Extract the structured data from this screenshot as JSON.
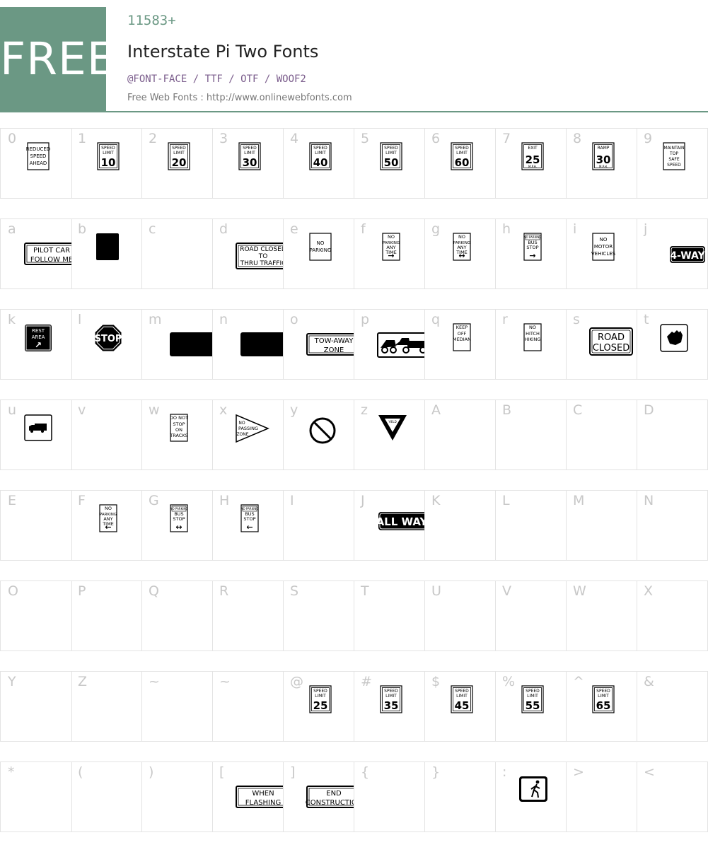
{
  "header": {
    "badge": "FREE",
    "count": "11583+",
    "title": "Interstate Pi Two Fonts",
    "formats": "@FONT-FACE / TTF / OTF / WOOF2",
    "site": "Free Web Fonts : http://www.onlinewebfonts.com"
  },
  "rows": [
    [
      {
        "char": "0",
        "sign": "sq",
        "lines": [
          "REDUCED",
          "SPEED",
          "AHEAD"
        ]
      },
      {
        "char": "1",
        "sign": "speed",
        "top": [
          "SPEED",
          "LIMIT"
        ],
        "num": "10"
      },
      {
        "char": "2",
        "sign": "speed",
        "top": [
          "SPEED",
          "LIMIT"
        ],
        "num": "20"
      },
      {
        "char": "3",
        "sign": "speed",
        "top": [
          "SPEED",
          "LIMIT"
        ],
        "num": "30"
      },
      {
        "char": "4",
        "sign": "speed",
        "top": [
          "SPEED",
          "LIMIT"
        ],
        "num": "40"
      },
      {
        "char": "5",
        "sign": "speed",
        "top": [
          "SPEED",
          "LIMIT"
        ],
        "num": "50"
      },
      {
        "char": "6",
        "sign": "speed",
        "top": [
          "SPEED",
          "LIMIT"
        ],
        "num": "60"
      },
      {
        "char": "7",
        "sign": "speed",
        "top": [
          "EXIT"
        ],
        "num": "25",
        "bottom": "M.P.H."
      },
      {
        "char": "8",
        "sign": "speed",
        "top": [
          "RAMP"
        ],
        "num": "30",
        "bottom": "M.P.H."
      },
      {
        "char": "9",
        "sign": "sq",
        "lines": [
          "MAINTAIN",
          "TOP",
          "SAFE",
          "SPEED"
        ]
      }
    ],
    [
      {
        "char": "a",
        "sign": "wide",
        "lines": [
          "PILOT CAR",
          "FOLLOW ME"
        ]
      },
      {
        "char": "b",
        "sign": "blackbox"
      },
      {
        "char": "c",
        "sign": "none"
      },
      {
        "char": "d",
        "sign": "wide2",
        "lines": [
          "ROAD  CLOSED",
          "TO",
          "THRU  TRAFFIC"
        ]
      },
      {
        "char": "e",
        "sign": "sq",
        "lines": [
          "NO",
          "PARKING"
        ]
      },
      {
        "char": "f",
        "sign": "tall",
        "lines": [
          "NO",
          "PARKING",
          "ANY",
          "TIME"
        ],
        "arrow": "→"
      },
      {
        "char": "g",
        "sign": "tall",
        "lines": [
          "NO",
          "PARKING",
          "ANY",
          "TIME"
        ],
        "arrow": "↔"
      },
      {
        "char": "h",
        "sign": "tall",
        "lines": [
          "NO PARKING",
          "BUS",
          "STOP"
        ],
        "arrow": "→"
      },
      {
        "char": "i",
        "sign": "sq",
        "lines": [
          "NO",
          "MOTOR",
          "VEHICLES"
        ]
      },
      {
        "char": "j",
        "sign": "pill",
        "lines": [
          "4-WAY"
        ]
      }
    ],
    [
      {
        "char": "k",
        "sign": "rest",
        "lines": [
          "REST",
          "AREA"
        ],
        "arrow": "↗"
      },
      {
        "char": "l",
        "sign": "stop",
        "lines": [
          "STOP"
        ]
      },
      {
        "char": "m",
        "sign": "blackwide"
      },
      {
        "char": "n",
        "sign": "blackwide"
      },
      {
        "char": "o",
        "sign": "wide",
        "lines": [
          "TOW-AWAY",
          "ZONE"
        ]
      },
      {
        "char": "p",
        "sign": "tow"
      },
      {
        "char": "q",
        "sign": "tall",
        "lines": [
          "KEEP",
          "OFF",
          "MEDIAN"
        ]
      },
      {
        "char": "r",
        "sign": "tall",
        "lines": [
          "NO",
          "HITCH",
          "HIKING"
        ]
      },
      {
        "char": "s",
        "sign": "roadclosed",
        "lines": [
          "ROAD",
          "CLOSED"
        ]
      },
      {
        "char": "t",
        "sign": "hand"
      }
    ],
    [
      {
        "char": "u",
        "sign": "truck"
      },
      {
        "char": "v",
        "sign": "none"
      },
      {
        "char": "w",
        "sign": "tall",
        "lines": [
          "DO NOT",
          "STOP",
          "ON",
          "TRACKS"
        ]
      },
      {
        "char": "x",
        "sign": "pennant",
        "lines": [
          "NO",
          "PASSING",
          "ZONE"
        ]
      },
      {
        "char": "y",
        "sign": "prohibit"
      },
      {
        "char": "z",
        "sign": "yield",
        "lines": [
          "YIELD"
        ]
      },
      {
        "char": "A",
        "sign": "none"
      },
      {
        "char": "B",
        "sign": "none"
      },
      {
        "char": "C",
        "sign": "none"
      },
      {
        "char": "D",
        "sign": "none"
      }
    ],
    [
      {
        "char": "E",
        "sign": "none"
      },
      {
        "char": "F",
        "sign": "tall",
        "lines": [
          "NO",
          "PARKING",
          "ANY",
          "TIME"
        ],
        "arrow": "←"
      },
      {
        "char": "G",
        "sign": "tall",
        "lines": [
          "NO PARKING",
          "BUS",
          "STOP"
        ],
        "arrow": "↔"
      },
      {
        "char": "H",
        "sign": "tall",
        "lines": [
          "NO PARKING",
          "BUS",
          "STOP"
        ],
        "arrow": "←"
      },
      {
        "char": "I",
        "sign": "none"
      },
      {
        "char": "J",
        "sign": "pillwide",
        "lines": [
          "ALL WAY"
        ]
      },
      {
        "char": "K",
        "sign": "none"
      },
      {
        "char": "L",
        "sign": "none"
      },
      {
        "char": "M",
        "sign": "none"
      },
      {
        "char": "N",
        "sign": "none"
      }
    ],
    [
      {
        "char": "O",
        "sign": "none"
      },
      {
        "char": "P",
        "sign": "none"
      },
      {
        "char": "Q",
        "sign": "none"
      },
      {
        "char": "R",
        "sign": "none"
      },
      {
        "char": "S",
        "sign": "none"
      },
      {
        "char": "T",
        "sign": "none"
      },
      {
        "char": "U",
        "sign": "none"
      },
      {
        "char": "V",
        "sign": "none"
      },
      {
        "char": "W",
        "sign": "none"
      },
      {
        "char": "X",
        "sign": "none"
      }
    ],
    [
      {
        "char": "Y",
        "sign": "none"
      },
      {
        "char": "Z",
        "sign": "none"
      },
      {
        "char": "~",
        "sign": "none"
      },
      {
        "char": "~",
        "sign": "none"
      },
      {
        "char": "@",
        "sign": "speed",
        "top": [
          "SPEED",
          "LIMIT"
        ],
        "num": "25"
      },
      {
        "char": "#",
        "sign": "speed",
        "top": [
          "SPEED",
          "LIMIT"
        ],
        "num": "35"
      },
      {
        "char": "$",
        "sign": "speed",
        "top": [
          "SPEED",
          "LIMIT"
        ],
        "num": "45"
      },
      {
        "char": "%",
        "sign": "speed",
        "top": [
          "SPEED",
          "LIMIT"
        ],
        "num": "55"
      },
      {
        "char": "^",
        "sign": "speed",
        "top": [
          "SPEED",
          "LIMIT"
        ],
        "num": "65"
      },
      {
        "char": "&",
        "sign": "none"
      }
    ],
    [
      {
        "char": "*",
        "sign": "none"
      },
      {
        "char": "(",
        "sign": "none"
      },
      {
        "char": ")",
        "sign": "none"
      },
      {
        "char": "[",
        "sign": "wide",
        "lines": [
          "WHEN",
          "FLASHING"
        ]
      },
      {
        "char": "]",
        "sign": "wide",
        "lines": [
          "END",
          "CONSTRUCTION"
        ]
      },
      {
        "char": "{",
        "sign": "none"
      },
      {
        "char": "}",
        "sign": "none"
      },
      {
        "char": ":",
        "sign": "ped"
      },
      {
        "char": ">",
        "sign": "none"
      },
      {
        "char": "<",
        "sign": "none"
      }
    ]
  ]
}
